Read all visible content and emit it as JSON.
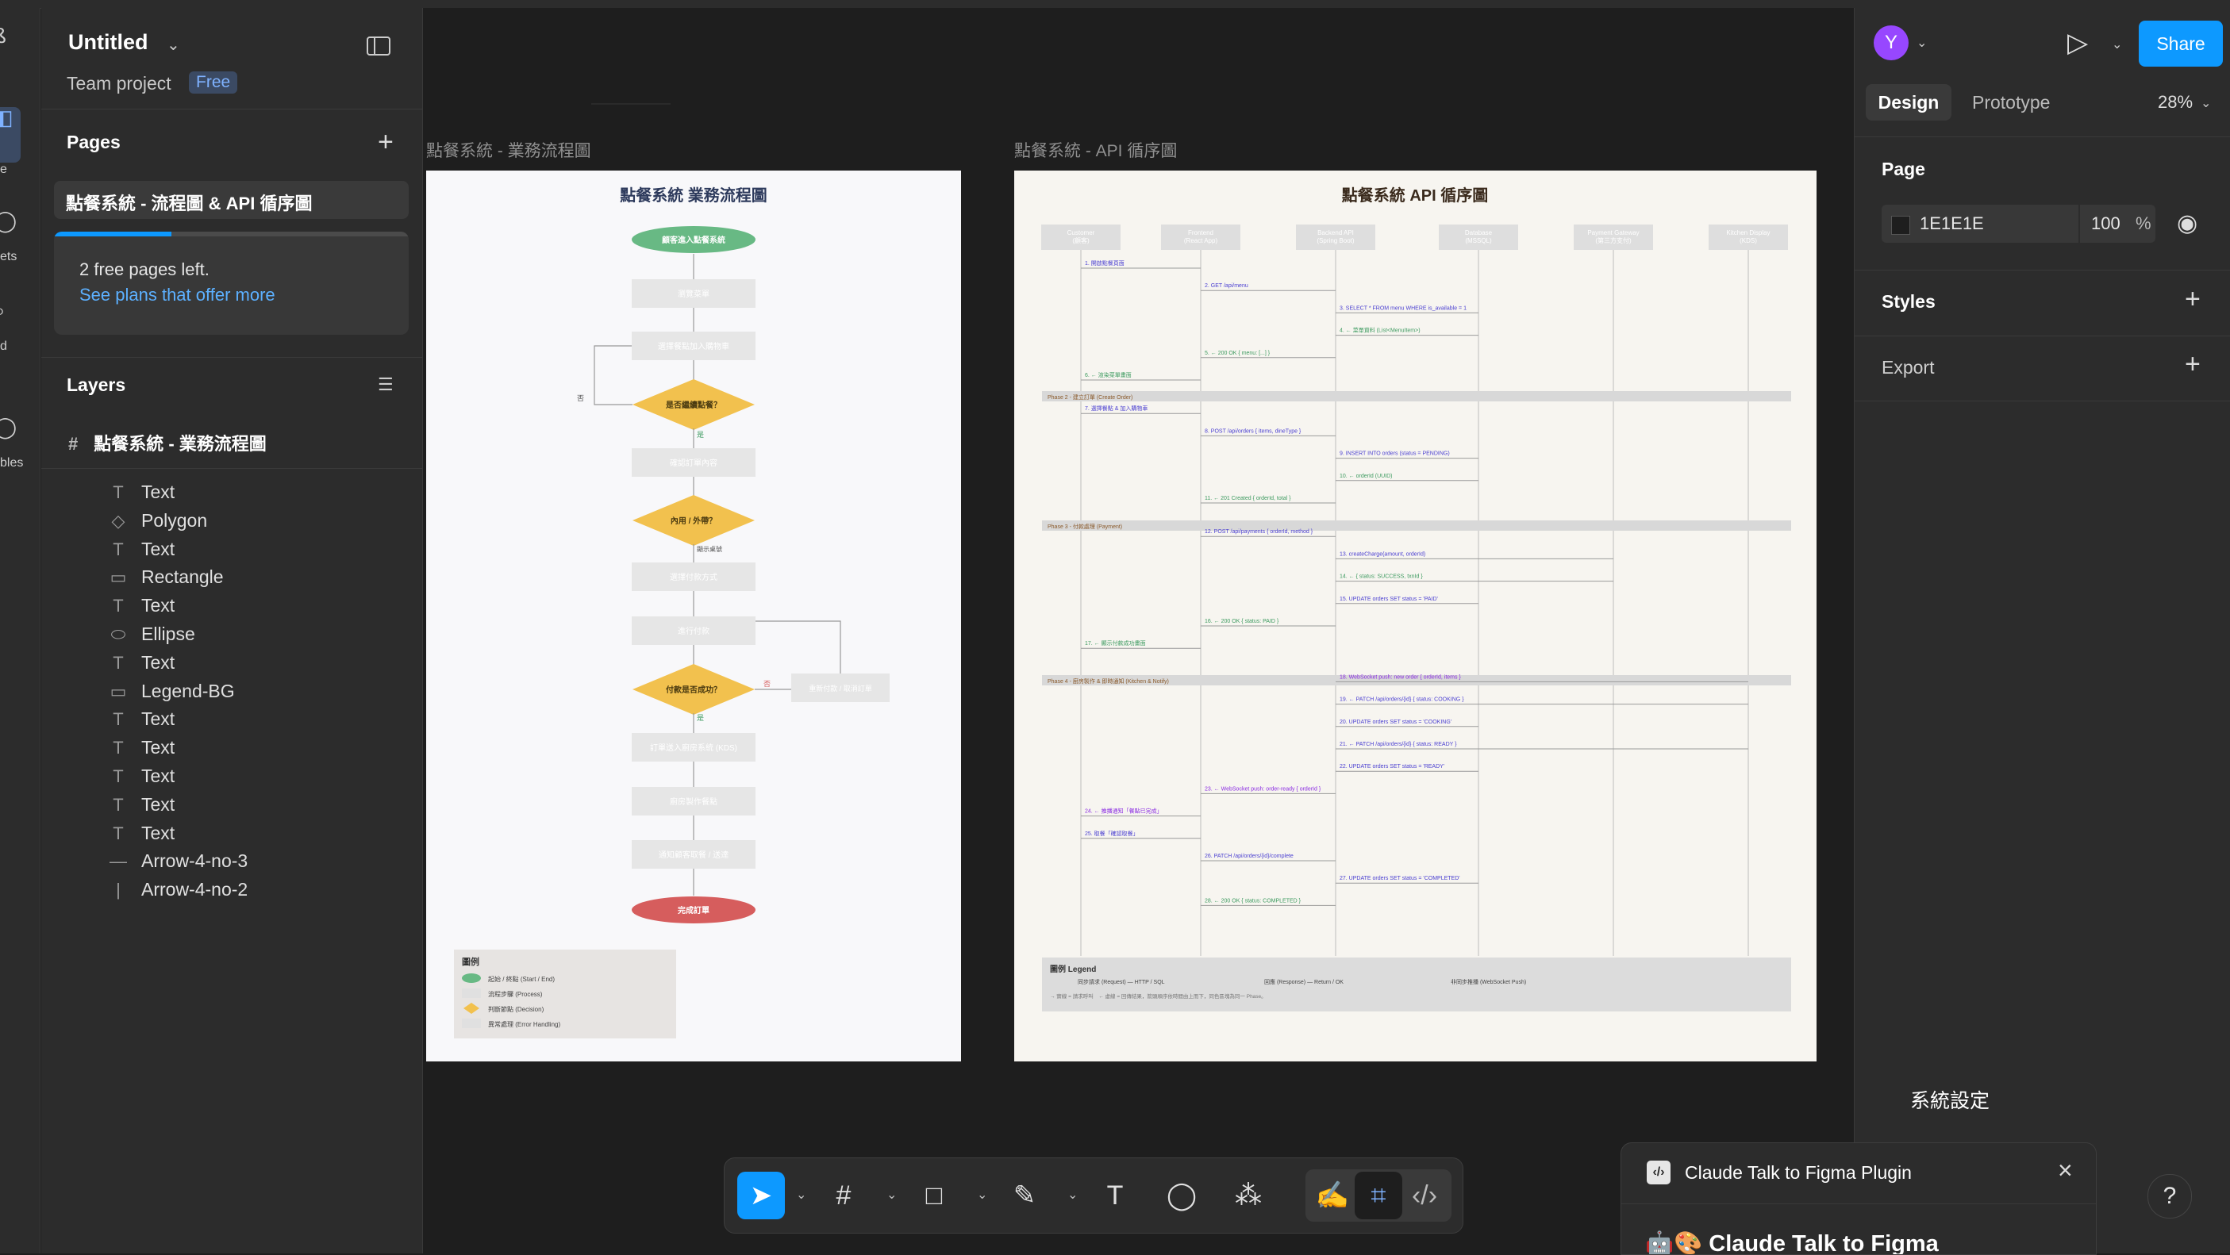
{
  "rail": {
    "items": [
      {
        "icon": "file-icon",
        "label": ""
      },
      {
        "icon": "layers-icon",
        "label": "e"
      },
      {
        "icon": "assets-icon",
        "label": "ets"
      },
      {
        "icon": "search-icon",
        "label": "d"
      },
      {
        "icon": "variables-icon",
        "label": "bles"
      }
    ]
  },
  "file": {
    "title": "Untitled",
    "team": "Team project",
    "plan": "Free"
  },
  "pages": {
    "heading": "Pages",
    "items": [
      "點餐系統 - 流程圖 & API 循序圖"
    ],
    "upsell": {
      "line1": "2 free pages left.",
      "link": "See plans that offer more",
      "progress": 0.33
    }
  },
  "layers": {
    "heading": "Layers",
    "root": "點餐系統 - 業務流程圖",
    "items": [
      {
        "type": "text",
        "name": "Text"
      },
      {
        "type": "polygon",
        "name": "Polygon"
      },
      {
        "type": "text",
        "name": "Text"
      },
      {
        "type": "rectangle",
        "name": "Rectangle"
      },
      {
        "type": "text",
        "name": "Text"
      },
      {
        "type": "ellipse",
        "name": "Ellipse"
      },
      {
        "type": "text",
        "name": "Text"
      },
      {
        "type": "rectangle",
        "name": "Legend-BG"
      },
      {
        "type": "text",
        "name": "Text"
      },
      {
        "type": "text",
        "name": "Text"
      },
      {
        "type": "text",
        "name": "Text"
      },
      {
        "type": "text",
        "name": "Text"
      },
      {
        "type": "text",
        "name": "Text"
      },
      {
        "type": "line",
        "name": "Arrow-4-no-3"
      },
      {
        "type": "vline",
        "name": "Arrow-4-no-2"
      }
    ]
  },
  "canvas": {
    "frame1": {
      "label": "點餐系統 - 業務流程圖",
      "title": "點餐系統 業務流程圖",
      "nodes": [
        {
          "kind": "terminal-start",
          "text": "顧客進入點餐系統"
        },
        {
          "kind": "process",
          "text": "瀏覽菜單"
        },
        {
          "kind": "process",
          "text": "選擇餐點加入購物車"
        },
        {
          "kind": "decision",
          "text": "是否繼續點餐？"
        },
        {
          "kind": "process",
          "text": "確認訂單內容"
        },
        {
          "kind": "decision",
          "text": "內用 / 外帶？"
        },
        {
          "kind": "process",
          "text": "選擇付款方式"
        },
        {
          "kind": "process",
          "text": "進行付款"
        },
        {
          "kind": "decision",
          "text": "付款是否成功？"
        },
        {
          "kind": "process",
          "text": "訂單送入廚房系統 (KDS)"
        },
        {
          "kind": "process",
          "text": "廚房製作餐點"
        },
        {
          "kind": "process",
          "text": "通知顧客取餐 / 送達"
        },
        {
          "kind": "terminal-end",
          "text": "完成訂單"
        }
      ],
      "edge_labels": {
        "yes": "是",
        "no": "否",
        "dine": "顯示桌號"
      },
      "error_node": "重新付款 / 取消訂單",
      "legend": {
        "title": "圖例",
        "items": [
          "起始 / 終點 (Start / End)",
          "流程步驟 (Process)",
          "判斷節點 (Decision)",
          "異常處理 (Error Handling)"
        ]
      }
    },
    "frame2": {
      "label": "點餐系統 - API 循序圖",
      "title": "點餐系統 API 循序圖",
      "participants": [
        "Customer\n(顧客)",
        "Frontend\n(React App)",
        "Backend API\n(Spring Boot)",
        "Database\n(MSSQL)",
        "Payment Gateway\n(第三方支付)",
        "Kitchen Display\n(KDS)"
      ],
      "phases": [
        "Phase 2 - 建立訂單 (Create Order)",
        "Phase 3 - 付款處理 (Payment)",
        "Phase 4 - 廚房製作 & 即時通知 (Kitchen & Notify)"
      ],
      "messages": [
        {
          "from": 0,
          "to": 1,
          "text": "1. 開啟點餐頁面",
          "color": "#4a3fd1"
        },
        {
          "from": 1,
          "to": 2,
          "text": "2. GET /api/menu",
          "color": "#4a3fd1"
        },
        {
          "from": 2,
          "to": 3,
          "text": "3. SELECT * FROM menu WHERE is_available = 1",
          "color": "#4a3fd1"
        },
        {
          "from": 3,
          "to": 2,
          "text": "4. ← 菜單資料 (List<MenuItem>)",
          "color": "#3c9a5f"
        },
        {
          "from": 2,
          "to": 1,
          "text": "5. ← 200 OK { menu: [...] }",
          "color": "#3c9a5f"
        },
        {
          "from": 1,
          "to": 0,
          "text": "6. ← 渲染菜單畫面",
          "color": "#3c9a5f"
        },
        {
          "from": 0,
          "to": 1,
          "text": "7. 選擇餐點 & 加入購物車",
          "color": "#4a3fd1"
        },
        {
          "from": 1,
          "to": 2,
          "text": "8. POST /api/orders { items, dineType }",
          "color": "#4a3fd1"
        },
        {
          "from": 2,
          "to": 3,
          "text": "9. INSERT INTO orders (status = PENDING)",
          "color": "#4a3fd1"
        },
        {
          "from": 3,
          "to": 2,
          "text": "10. ← orderId (UUID)",
          "color": "#3c9a5f"
        },
        {
          "from": 2,
          "to": 1,
          "text": "11. ← 201 Created { orderId, total }",
          "color": "#3c9a5f"
        },
        {
          "from": 1,
          "to": 2,
          "text": "12. POST /api/payments { orderId, method }",
          "color": "#4a3fd1"
        },
        {
          "from": 2,
          "to": 4,
          "text": "13. createCharge(amount, orderId)",
          "color": "#4a3fd1"
        },
        {
          "from": 4,
          "to": 2,
          "text": "14. ← { status: SUCCESS, txnId }",
          "color": "#3c9a5f"
        },
        {
          "from": 2,
          "to": 3,
          "text": "15. UPDATE orders SET status = 'PAID'",
          "color": "#4a3fd1"
        },
        {
          "from": 2,
          "to": 1,
          "text": "16. ← 200 OK { status: PAID }",
          "color": "#3c9a5f"
        },
        {
          "from": 1,
          "to": 0,
          "text": "17. ← 顯示付款成功畫面",
          "color": "#3c9a5f"
        },
        {
          "from": 2,
          "to": 5,
          "text": "18. WebSocket push: new order { orderId, items }",
          "color": "#8a2be2"
        },
        {
          "from": 5,
          "to": 2,
          "text": "19. ← PATCH /api/orders/{id} { status: COOKING }",
          "color": "#4a3fd1"
        },
        {
          "from": 2,
          "to": 3,
          "text": "20. UPDATE orders SET status = 'COOKING'",
          "color": "#4a3fd1"
        },
        {
          "from": 5,
          "to": 2,
          "text": "21. ← PATCH /api/orders/{id} { status: READY }",
          "color": "#4a3fd1"
        },
        {
          "from": 2,
          "to": 3,
          "text": "22. UPDATE orders SET status = 'READY'",
          "color": "#4a3fd1"
        },
        {
          "from": 2,
          "to": 1,
          "text": "23. ← WebSocket push: order-ready { orderId }",
          "color": "#8a2be2"
        },
        {
          "from": 1,
          "to": 0,
          "text": "24. ← 推播通知「餐點已完成」",
          "color": "#8a2be2"
        },
        {
          "from": 0,
          "to": 1,
          "text": "25. 取餐「確認取餐」",
          "color": "#4a3fd1"
        },
        {
          "from": 1,
          "to": 2,
          "text": "26. PATCH /api/orders/{id}/complete",
          "color": "#4a3fd1"
        },
        {
          "from": 2,
          "to": 3,
          "text": "27. UPDATE orders SET status = 'COMPLETED'",
          "color": "#4a3fd1"
        },
        {
          "from": 2,
          "to": 1,
          "text": "28. ← 200 OK { status: COMPLETED }",
          "color": "#3c9a5f"
        }
      ],
      "legend": {
        "title": "圖例 Legend",
        "items": [
          "同步請求 (Request) — HTTP / SQL",
          "回應 (Response) — Return / OK",
          "非同步推播 (WebSocket Push)"
        ],
        "note": "→ 實線 = 請求呼叫　← 虛線 = 回傳結果，箭頭順序依時間由上而下，同色區塊為同一 Phase。"
      }
    }
  },
  "right": {
    "avatar": "Y",
    "share": "Share",
    "tabs": [
      "Design",
      "Prototype"
    ],
    "zoom": "28%",
    "page": {
      "heading": "Page",
      "color": "1E1E1E",
      "opacity": "100",
      "unit": "%"
    },
    "styles": "Styles",
    "export": "Export",
    "floating_text": "系統設定"
  },
  "toolbar": {
    "tools": [
      "move-icon",
      "frame-icon",
      "shape-icon",
      "pen-icon",
      "text-icon",
      "comment-icon",
      "actions-icon",
      "draw-icon",
      "design-mode-icon",
      "dev-mode-icon"
    ]
  },
  "plugin": {
    "title": "Claude Talk to Figma Plugin",
    "body_title": "🤖🎨 Claude Talk to Figma"
  },
  "help": "?"
}
